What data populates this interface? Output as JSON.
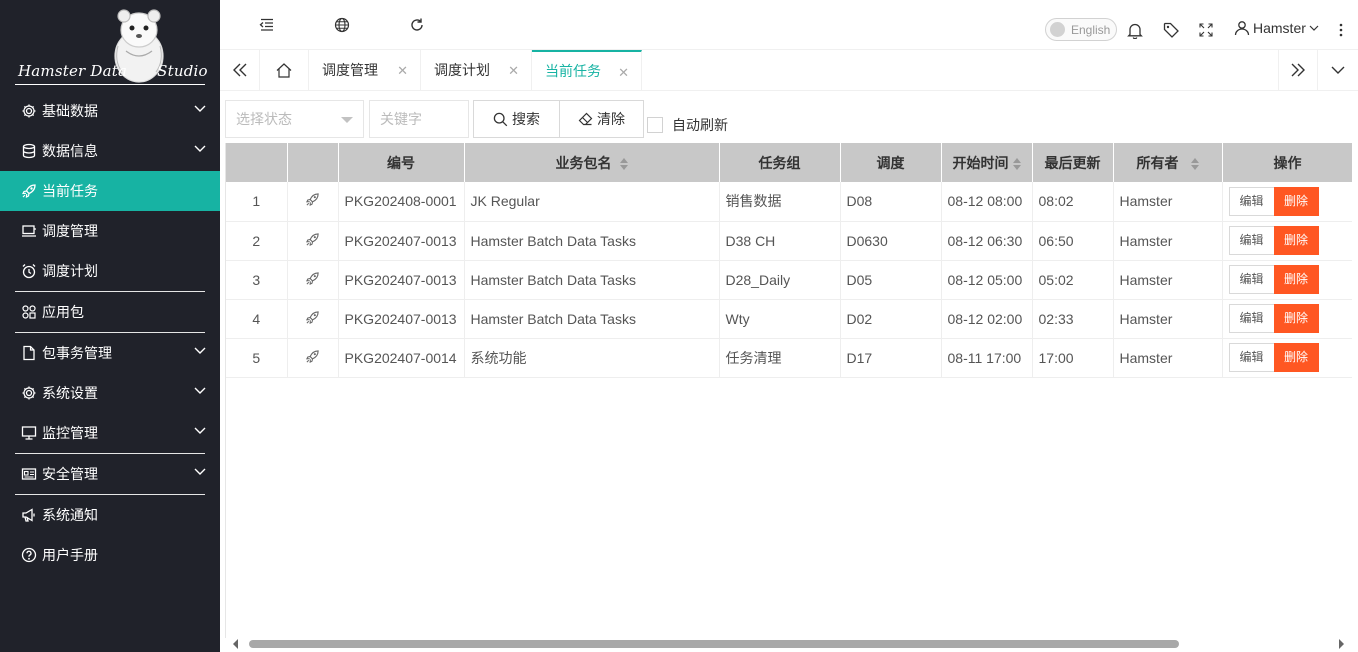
{
  "sidebar": {
    "logo_text_left": "Hamster Data",
    "logo_text_right": "Studio",
    "items": [
      {
        "label": "基础数据",
        "icon": "gear-icon",
        "expandable": true
      },
      {
        "label": "数据信息",
        "icon": "database-icon",
        "expandable": true
      },
      {
        "label": "当前任务",
        "icon": "rocket-icon",
        "expandable": false,
        "active": true
      },
      {
        "label": "调度管理",
        "icon": "monitor-icon",
        "expandable": false
      },
      {
        "label": "调度计划",
        "icon": "alarm-clock-icon",
        "expandable": false
      },
      {
        "label": "应用包",
        "icon": "apps-icon",
        "expandable": false
      },
      {
        "label": "包事务管理",
        "icon": "file-icon",
        "expandable": true
      },
      {
        "label": "系统设置",
        "icon": "gear-icon",
        "expandable": true
      },
      {
        "label": "监控管理",
        "icon": "monitor-icon",
        "expandable": true
      },
      {
        "label": "安全管理",
        "icon": "id-card-icon",
        "expandable": true
      },
      {
        "label": "系统通知",
        "icon": "megaphone-icon",
        "expandable": false
      },
      {
        "label": "用户手册",
        "icon": "help-icon",
        "expandable": false
      }
    ]
  },
  "header": {
    "language_label": "English",
    "user_name": "Hamster"
  },
  "tabs": [
    {
      "label": "调度管理",
      "active": false
    },
    {
      "label": "调度计划",
      "active": false
    },
    {
      "label": "当前任务",
      "active": true
    }
  ],
  "toolbar": {
    "status_placeholder": "选择状态",
    "keyword_placeholder": "关键字",
    "search_label": "搜索",
    "clear_label": "清除",
    "autorefresh_label": "自动刷新"
  },
  "table": {
    "columns": [
      "",
      "",
      "编号",
      "业务包名",
      "任务组",
      "调度",
      "开始时间",
      "最后更新",
      "所有者",
      "操作"
    ],
    "edit_label": "编辑",
    "delete_label": "删除",
    "rows": [
      {
        "index": "1",
        "code": "PKG202408-0001",
        "package": "JK Regular",
        "group": "销售数据",
        "schedule": "D08",
        "start": "08-12 08:00",
        "updated": "08:02",
        "owner": "Hamster"
      },
      {
        "index": "2",
        "code": "PKG202407-0013",
        "package": "Hamster Batch Data Tasks",
        "group": "D38 CH",
        "schedule": "D0630",
        "start": "08-12 06:30",
        "updated": "06:50",
        "owner": "Hamster"
      },
      {
        "index": "3",
        "code": "PKG202407-0013",
        "package": "Hamster Batch Data Tasks",
        "group": "D28_Daily",
        "schedule": "D05",
        "start": "08-12 05:00",
        "updated": "05:02",
        "owner": "Hamster"
      },
      {
        "index": "4",
        "code": "PKG202407-0013",
        "package": "Hamster Batch Data Tasks",
        "group": "Wty",
        "schedule": "D02",
        "start": "08-12 02:00",
        "updated": "02:33",
        "owner": "Hamster"
      },
      {
        "index": "5",
        "code": "PKG202407-0014",
        "package": "系统功能",
        "group": "任务清理",
        "schedule": "D17",
        "start": "08-11 17:00",
        "updated": "17:00",
        "owner": "Hamster"
      }
    ]
  },
  "colors": {
    "sidebar_bg": "#20222a",
    "accent": "#17b3a3",
    "danger": "#ff5722",
    "header_row_bg": "#c8c8c8"
  }
}
